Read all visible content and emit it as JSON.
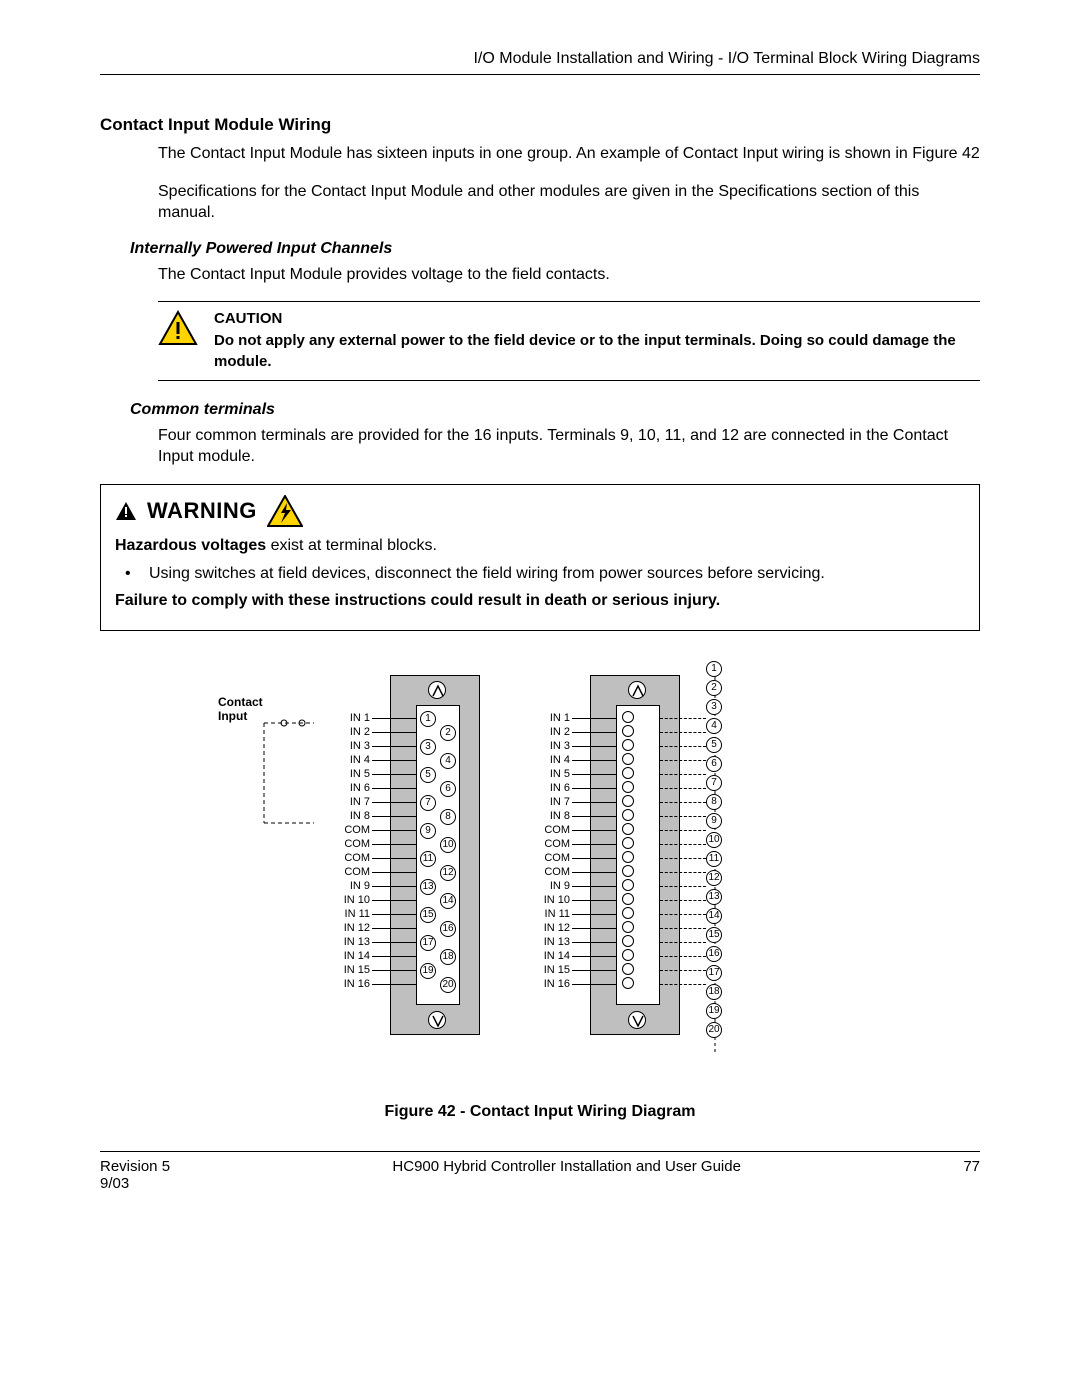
{
  "header": "I/O Module Installation and Wiring - I/O Terminal Block Wiring Diagrams",
  "section_title": "Contact Input Module Wiring",
  "para1": "The Contact Input Module has sixteen inputs in one group.  An example of Contact Input wiring is shown in Figure 42",
  "para2": "Specifications for the Contact Input Module and other modules are given in the Specifications section of this manual.",
  "sub1": "Internally Powered Input Channels",
  "sub1_para": "The Contact Input Module provides voltage to the field contacts.",
  "caution": {
    "label": "CAUTION",
    "body": "Do not apply any external power to the field device or to the input terminals. Doing so could damage the module."
  },
  "sub2": "Common terminals",
  "sub2_para": "Four common terminals are provided for the 16 inputs.  Terminals 9, 10, 11, and 12 are connected in the Contact Input module.",
  "warning": {
    "word": "WARNING",
    "line1_bold": "Hazardous voltages",
    "line1_rest": " exist at terminal blocks.",
    "bullet": "Using switches at field devices, disconnect the field wiring from power sources before servicing.",
    "line2": "Failure to comply with these instructions could result in death or serious injury."
  },
  "figure": {
    "contact_label_1": "Contact",
    "contact_label_2": "Input",
    "labels": [
      "IN 1",
      "IN 2",
      "IN 3",
      "IN 4",
      "IN 5",
      "IN 6",
      "IN 7",
      "IN 8",
      "COM",
      "COM",
      "COM",
      "COM",
      "IN 9",
      "IN 10",
      "IN 11",
      "IN 12",
      "IN 13",
      "IN 14",
      "IN 15",
      "IN 16"
    ],
    "caption": "Figure 42 - Contact Input Wiring Diagram"
  },
  "footer": {
    "left1": "Revision 5",
    "left2": "9/03",
    "center": "HC900 Hybrid Controller Installation and User Guide",
    "right": "77"
  }
}
